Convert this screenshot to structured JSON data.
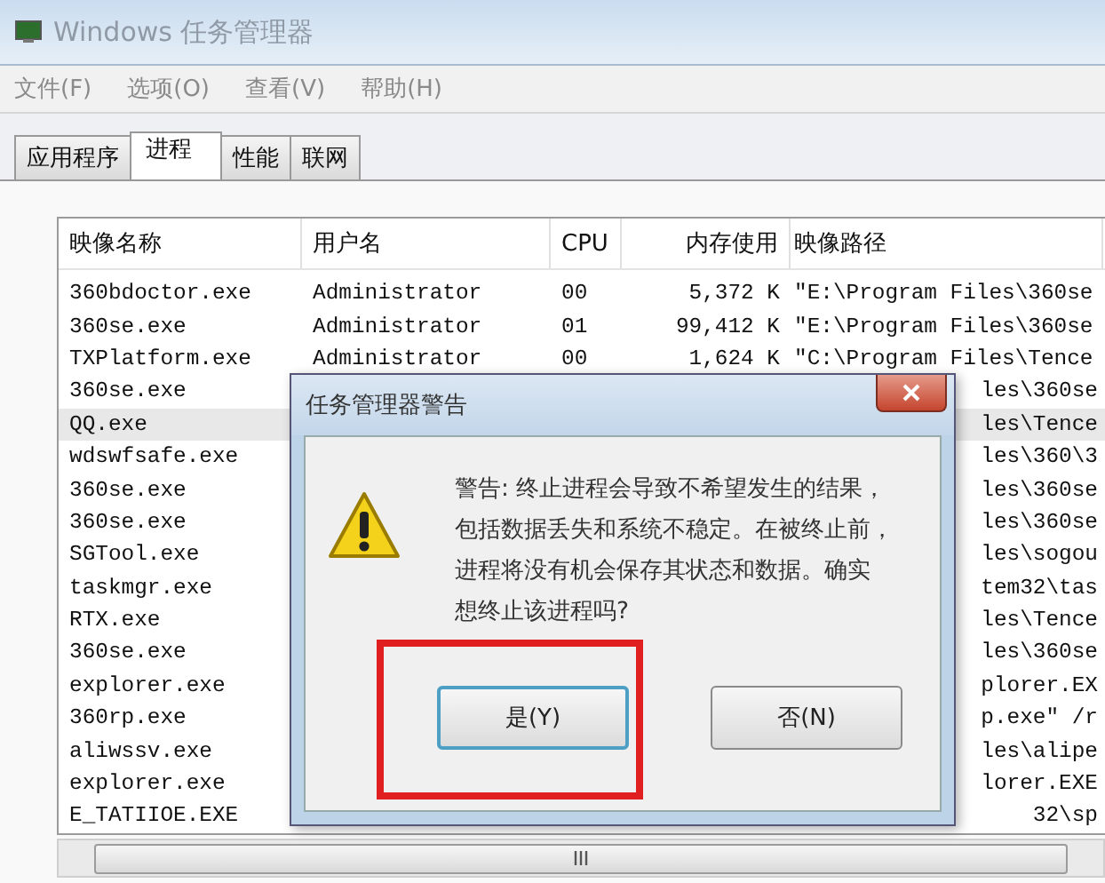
{
  "window": {
    "title": "Windows 任务管理器"
  },
  "menu": [
    "文件(F)",
    "选项(O)",
    "查看(V)",
    "帮助(H)"
  ],
  "tabs": [
    {
      "label": "应用程序",
      "selected": false
    },
    {
      "label": "进程",
      "selected": true
    },
    {
      "label": "性能",
      "selected": false
    },
    {
      "label": "联网",
      "selected": false
    }
  ],
  "table": {
    "columns": [
      "映像名称",
      "用户名",
      "CPU",
      "内存使用",
      "映像路径"
    ],
    "rows": [
      {
        "name": "360bdoctor.exe",
        "user": "Administrator",
        "cpu": "00",
        "memory": "5,372 K",
        "path": "\"E:\\Program Files\\360se",
        "selected": false
      },
      {
        "name": "360se.exe",
        "user": "Administrator",
        "cpu": "01",
        "memory": "99,412 K",
        "path": "\"E:\\Program Files\\360se",
        "selected": false
      },
      {
        "name": "TXPlatform.exe",
        "user": "Administrator",
        "cpu": "00",
        "memory": "1,624 K",
        "path": "\"C:\\Program Files\\Tence",
        "selected": false
      },
      {
        "name": "360se.exe",
        "path": "les\\360se",
        "selected": false
      },
      {
        "name": "QQ.exe",
        "path": "les\\Tence",
        "selected": true
      },
      {
        "name": "wdswfsafe.exe",
        "path": "les\\360\\3",
        "selected": false
      },
      {
        "name": "360se.exe",
        "path": "les\\360se",
        "selected": false
      },
      {
        "name": "360se.exe",
        "path": "les\\360se",
        "selected": false
      },
      {
        "name": "SGTool.exe",
        "path": "les\\sogou",
        "selected": false
      },
      {
        "name": "taskmgr.exe",
        "path": "tem32\\tas",
        "selected": false
      },
      {
        "name": "RTX.exe",
        "path": "les\\Tence",
        "selected": false
      },
      {
        "name": "360se.exe",
        "path": "les\\360se",
        "selected": false
      },
      {
        "name": "explorer.exe",
        "path": "plorer.EX",
        "selected": false
      },
      {
        "name": "360rp.exe",
        "path": "p.exe\" /r",
        "selected": false
      },
      {
        "name": "aliwssv.exe",
        "path": "les\\alipe",
        "selected": false
      },
      {
        "name": "explorer.exe",
        "path": "lorer.EXE",
        "selected": false
      },
      {
        "name": "E_TATIIOE.EXE",
        "path": "32\\sp",
        "selected": false
      }
    ]
  },
  "dialog": {
    "title": "任务管理器警告",
    "message_lines": [
      "警告: 终止进程会导致不希望发生的结果，",
      "包括数据丢失和系统不稳定。在被终止前，",
      "进程将没有机会保存其状态和数据。确实",
      "想终止该进程吗?"
    ],
    "buttons": [
      {
        "label": "是(Y)",
        "highlighted": true
      },
      {
        "label": "否(N)",
        "highlighted": false
      }
    ]
  }
}
